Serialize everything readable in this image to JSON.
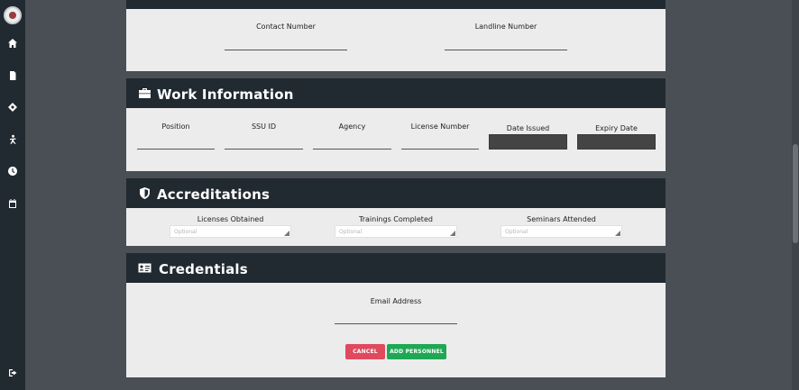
{
  "sidebar": {
    "icons": [
      "home-icon",
      "document-icon",
      "compass-icon",
      "person-icon",
      "clock-icon",
      "calendar-icon",
      "logout-icon"
    ]
  },
  "contact": {
    "contact_number_label": "Contact Number",
    "landline_number_label": "Landline Number"
  },
  "work": {
    "title": "Work Information",
    "fields": {
      "position": "Position",
      "ssu_id": "SSU ID",
      "agency": "Agency",
      "license_number": "License Number",
      "date_issued": "Date Issued",
      "expiry_date": "Expiry Date"
    }
  },
  "accreditations": {
    "title": "Accreditations",
    "licenses_label": "Licenses Obtained",
    "trainings_label": "Trainings Completed",
    "seminars_label": "Seminars Attended",
    "placeholder": "Optional"
  },
  "credentials": {
    "title": "Credentials",
    "email_label": "Email Address",
    "cancel_label": "CANCEL",
    "add_label": "ADD PERSONNEL"
  },
  "colors": {
    "sidebar": "#212931",
    "header": "#212931",
    "card": "#ececec",
    "background": "#4a4f56",
    "cancel": "#df4a5f",
    "add": "#1fa854"
  }
}
